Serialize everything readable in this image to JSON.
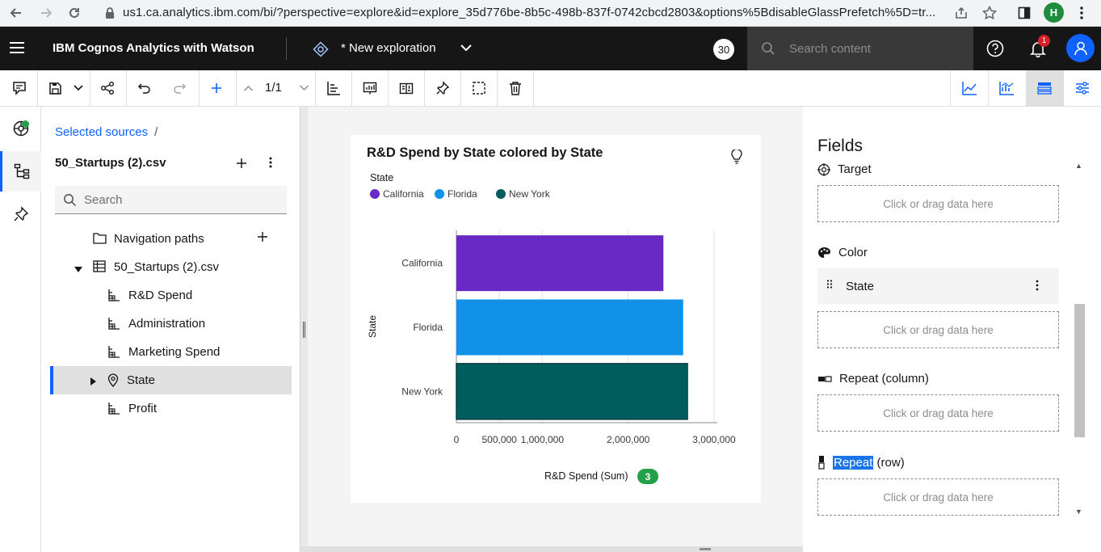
{
  "browser": {
    "url": "us1.ca.analytics.ibm.com/bi/?perspective=explore&id=explore_35d776be-8b5c-498b-837f-0742cbcd2803&options%5BdisableGlassPrefetch%5D=tr...",
    "profile_initial": "H"
  },
  "header": {
    "brand": "IBM Cognos Analytics with Watson",
    "exploration_title": "* New exploration",
    "count_badge": "30",
    "search_placeholder": "Search content",
    "notification_count": "1"
  },
  "toolbar": {
    "page_indicator": "1/1"
  },
  "sources": {
    "breadcrumb_link": "Selected sources",
    "breadcrumb_sep": "/",
    "title": "50_Startups (2).csv",
    "search_placeholder": "Search",
    "tree": {
      "navigation_paths": "Navigation paths",
      "file": "50_Startups (2).csv",
      "items": [
        "R&D Spend",
        "Administration",
        "Marketing Spend",
        "State",
        "Profit"
      ]
    }
  },
  "card": {
    "title": "R&D Spend by State colored by State",
    "legend_title": "State",
    "footer_count": "3"
  },
  "chart_data": {
    "type": "bar",
    "orientation": "horizontal",
    "title": "R&D Spend by State colored by State",
    "categories": [
      "California",
      "Florida",
      "New York"
    ],
    "values": [
      2410000,
      2640000,
      2690000
    ],
    "colors": [
      "#6929c4",
      "#1192e8",
      "#005d5d"
    ],
    "legend": {
      "title": "State",
      "entries": [
        "California",
        "Florida",
        "New York"
      ],
      "placement": "top-left"
    },
    "xlabel": "R&D Spend (Sum)",
    "ylabel": "State",
    "xlim": [
      0,
      3000000
    ],
    "xticks": [
      "0",
      "500,000",
      "1,000,000",
      "2,000,000",
      "3,000,000"
    ],
    "xtick_values": [
      0,
      500000,
      1000000,
      2000000,
      3000000
    ],
    "grid": true
  },
  "fields": {
    "title": "Fields",
    "target_label": "Target",
    "color_label": "Color",
    "color_field": "State",
    "repeat_column_label": "Repeat (column)",
    "repeat_row_highlight": "Repeat",
    "repeat_row_rest": " (row)",
    "drop_text": "Click or drag data here"
  }
}
